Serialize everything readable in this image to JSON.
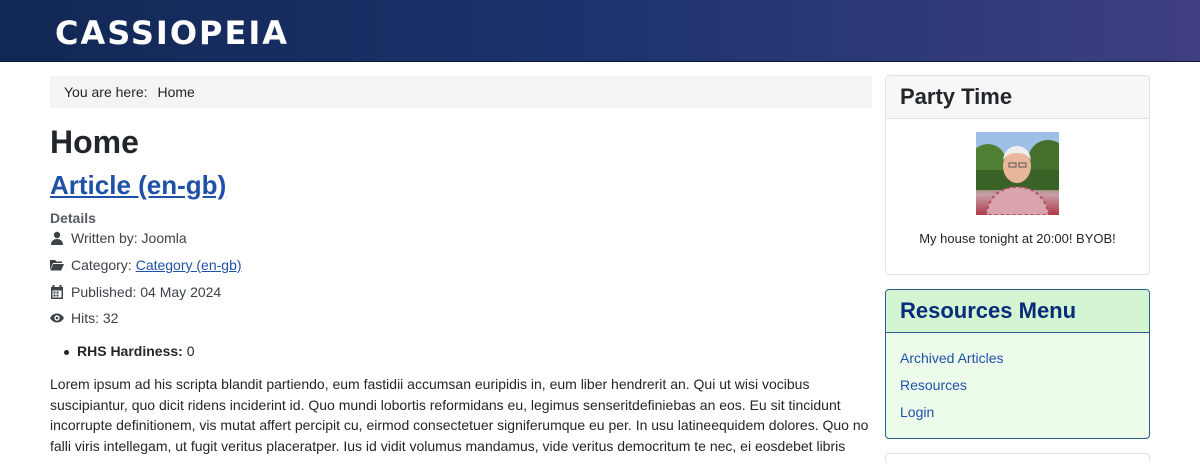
{
  "header": {
    "brand": "CASSIOPEIA"
  },
  "breadcrumb": {
    "prefix": "You are here:",
    "home": "Home"
  },
  "page": {
    "heading": "Home"
  },
  "article": {
    "title": "Article (en-gb)",
    "details_label": "Details",
    "author": "Written by: Joomla",
    "category_prefix": "Category:",
    "category_link": "Category (en-gb)",
    "published": "Published: 04 May 2024",
    "hits": "Hits: 32",
    "field_name": "RHS Hardiness:",
    "field_value": "0",
    "body": "Lorem ipsum ad his scripta blandit partiendo, eum fastidii accumsan euripidis in, eum liber hendrerit an. Qui ut wisi vocibus suscipiantur, quo dicit ridens inciderint id. Quo mundi lobortis reformidans eu, legimus senseritdefiniebas an eos. Eu sit tincidunt incorrupte definitionem, vis mutat affert percipit cu, eirmod consectetuer signiferumque eu per. In usu latineequidem dolores. Quo no falli viris intellegam, ut fugit veritus placeratper. Ius id vidit volumus mandamus, vide veritus democritum te nec, ei eosdebet libris"
  },
  "sidebar": {
    "party": {
      "title": "Party Time",
      "text": "My house tonight at 20:00! BYOB!"
    },
    "resources": {
      "title": "Resources Menu",
      "items": [
        "Archived Articles",
        "Resources",
        "Login"
      ]
    }
  },
  "icons": {
    "author": "user-icon",
    "category": "folder-open-icon",
    "published": "calendar-icon",
    "hits": "eye-icon"
  },
  "colors": {
    "header_start": "#112855",
    "header_end": "#3f3f82",
    "link": "#1f51a8",
    "menu_bg": "#ecfbea",
    "menu_title": "#0a2a7a"
  }
}
